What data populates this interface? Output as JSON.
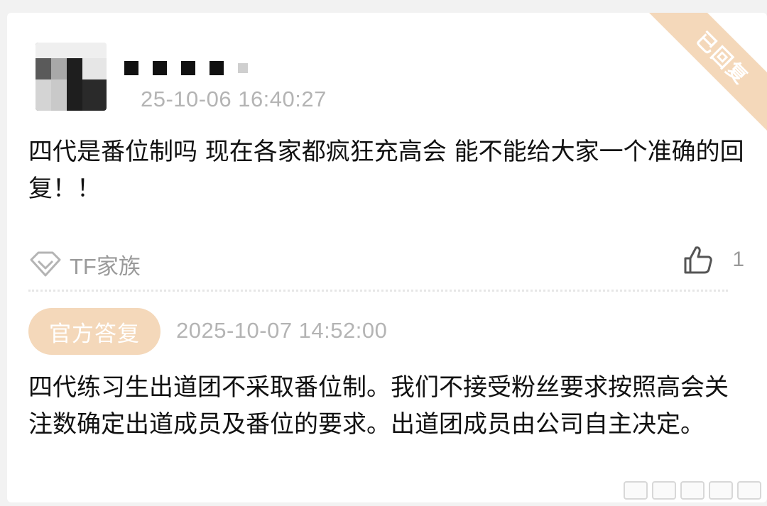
{
  "question": {
    "author_time": "25-10-06 16:40:27",
    "text": "四代是番位制吗  现在各家都疯狂充高会  能不能给大家一个准确的回复！！",
    "source_label": "TF家族",
    "like_count": "1",
    "status_badge": "已回复"
  },
  "answer": {
    "label": "官方答复",
    "time": "2025-10-07 14:52:00",
    "text": "四代练习生出道团不采取番位制。我们不接受粉丝要求按照高会关注数确定出道成员及番位的要求。出道团成员由公司自主决定。"
  },
  "colors": {
    "accent": "#f4d8ba",
    "muted_text": "#b4b4b4",
    "body_text": "#111111"
  },
  "icons": {
    "source": "diamond-icon",
    "like": "thumbs-up-icon"
  }
}
